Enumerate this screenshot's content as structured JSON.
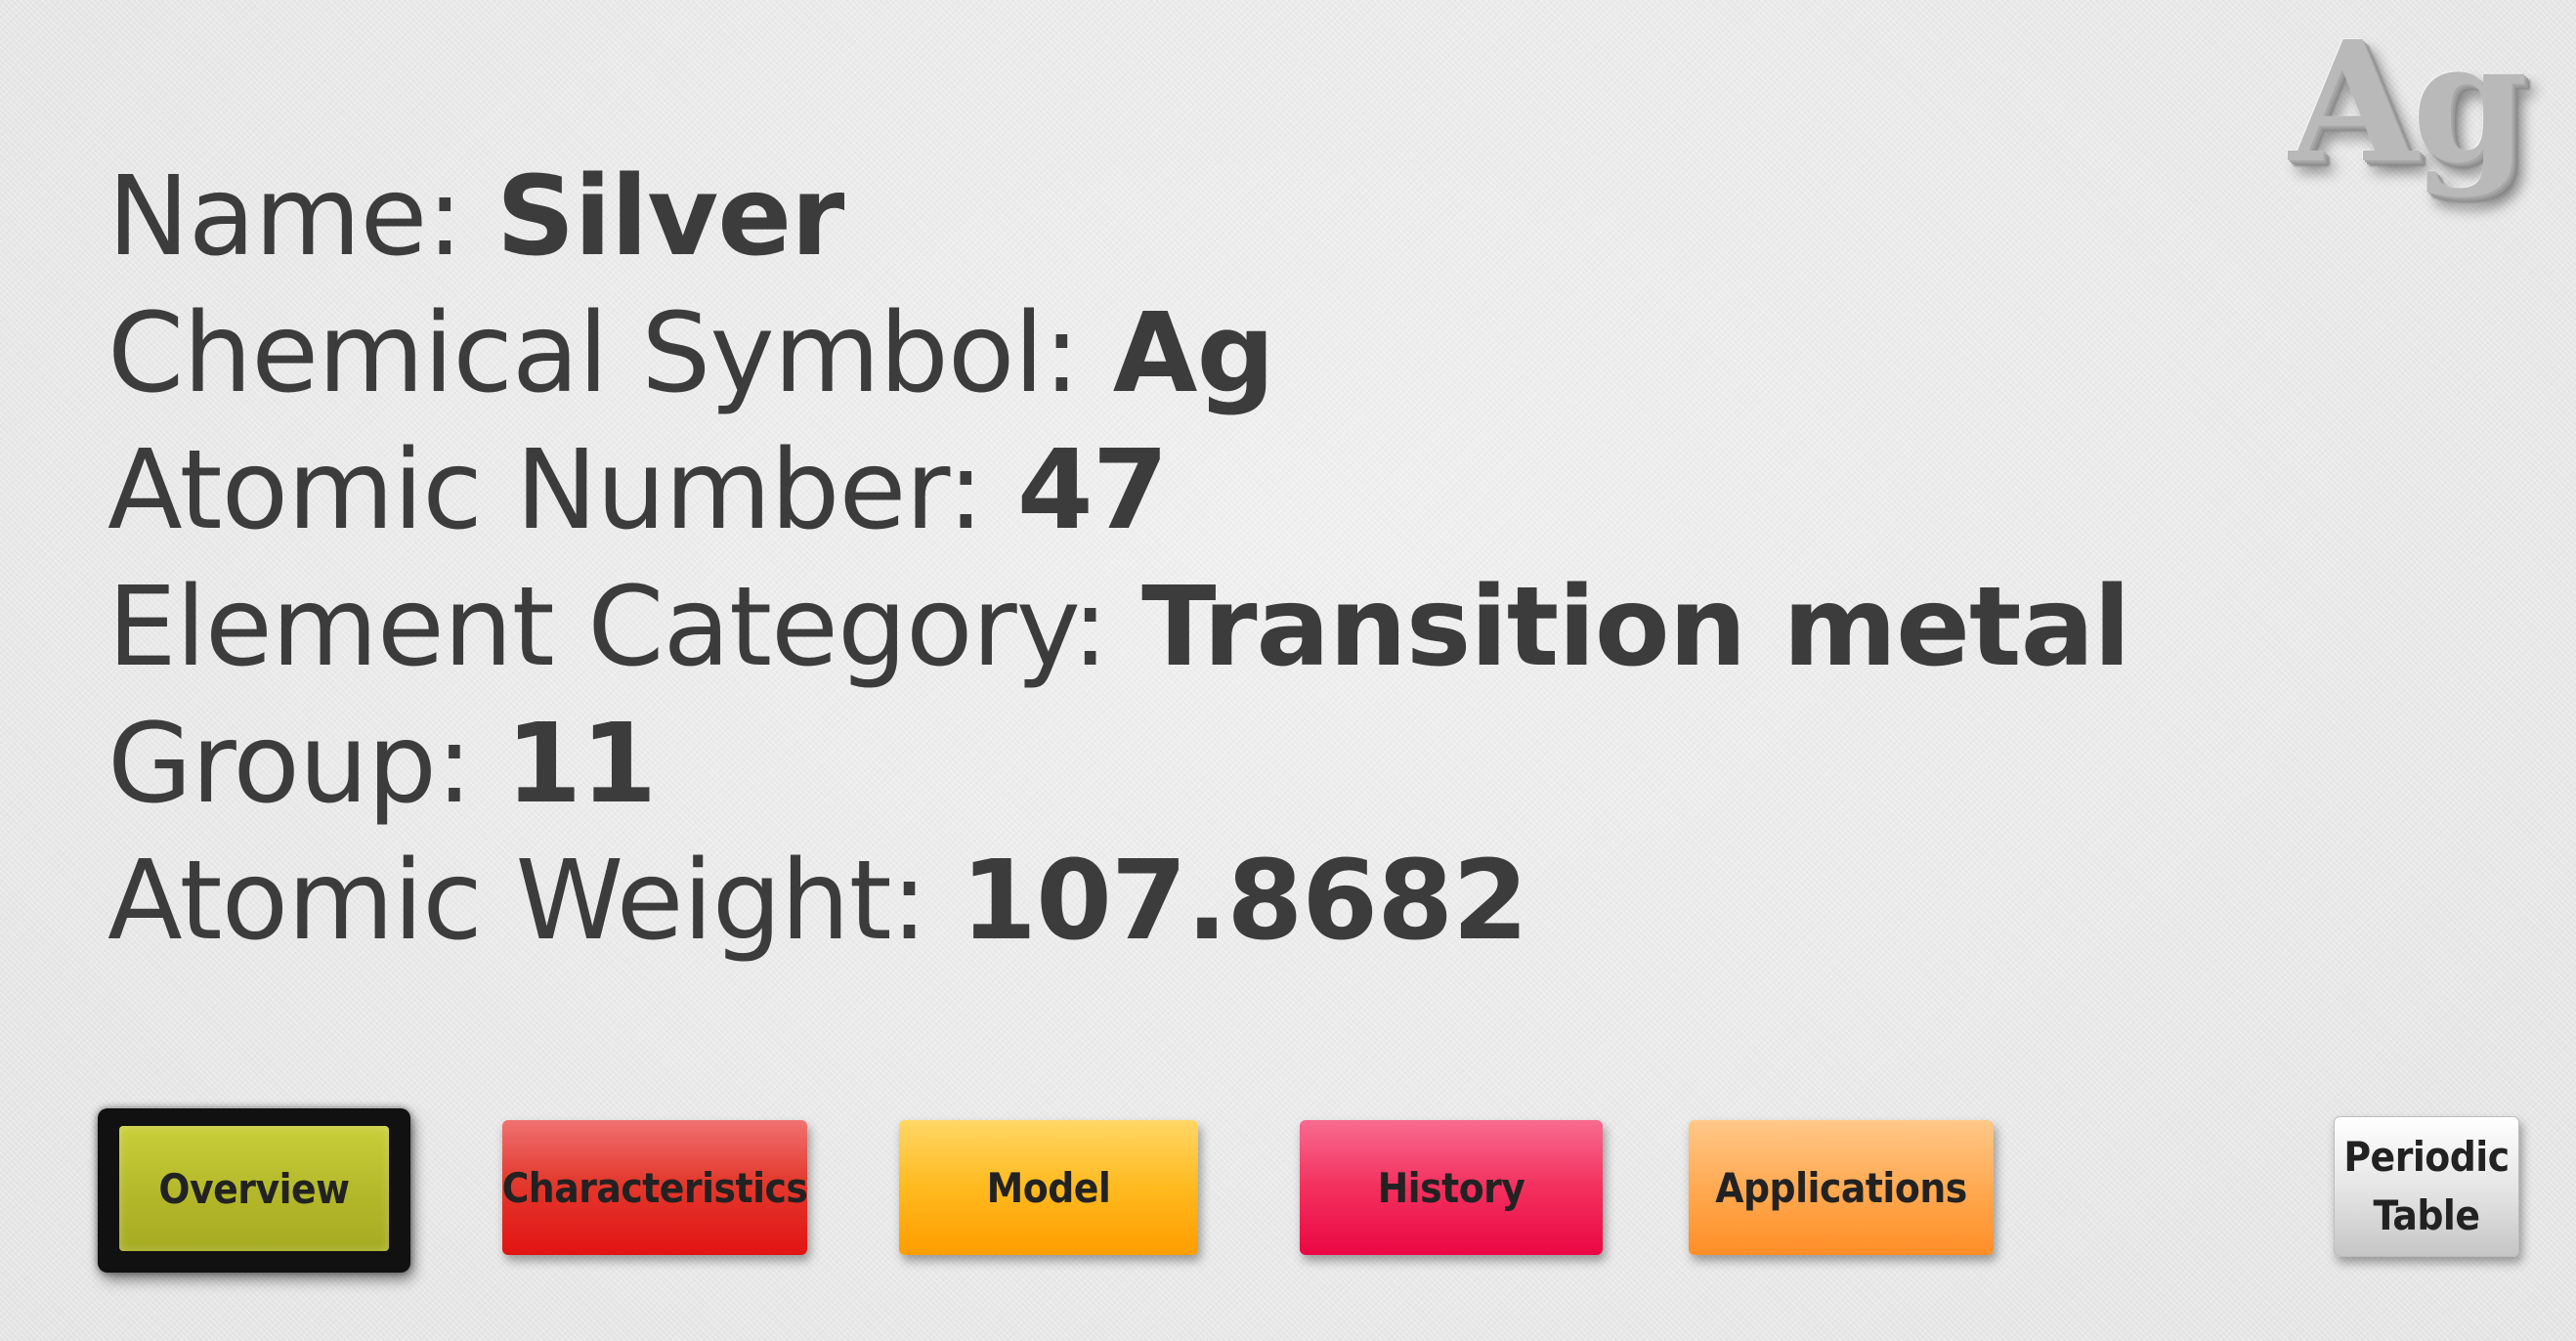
{
  "element": {
    "symbol_badge": "Ag"
  },
  "info": [
    {
      "label": "Name: ",
      "value": "Silver"
    },
    {
      "label": "Chemical Symbol: ",
      "value": "Ag"
    },
    {
      "label": "Atomic Number: ",
      "value": "47"
    },
    {
      "label": "Element Category: ",
      "value": "Transition metal"
    },
    {
      "label": "Group: ",
      "value": "11"
    },
    {
      "label": "Atomic Weight: ",
      "value": "107.8682"
    }
  ],
  "nav": {
    "overview": "Overview",
    "characteristics": "Characteristics",
    "model": "Model",
    "history": "History",
    "applications": "Applications",
    "periodic_table_line1": "Periodic",
    "periodic_table_line2": "Table",
    "selected": "Overview"
  },
  "colors": {
    "overview": "#b3b82a",
    "characteristics": "#e21313",
    "model": "#ffba1f",
    "history": "#f3305e",
    "applications": "#ffaa52",
    "periodic_table": "#e3e3e3"
  }
}
